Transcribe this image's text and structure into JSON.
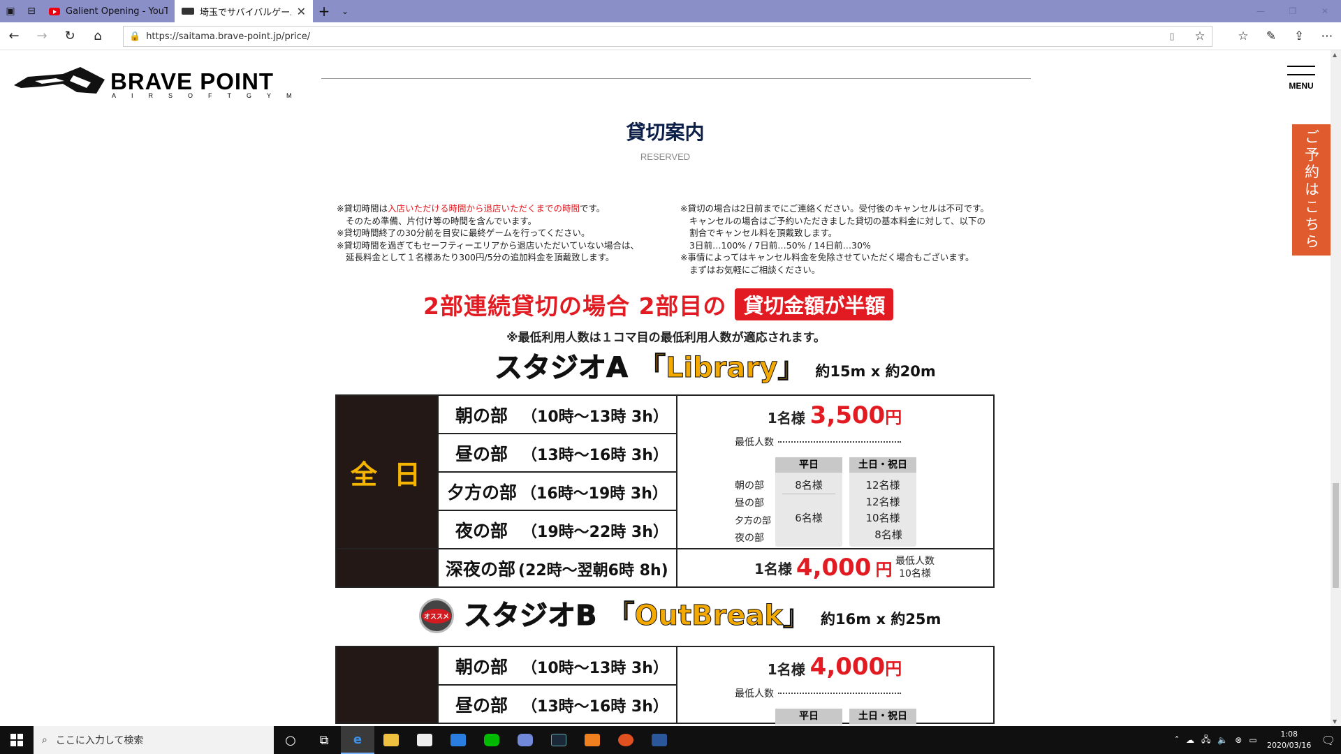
{
  "browser": {
    "tabs": [
      {
        "title": "Galient Opening - YouTube",
        "active": false
      },
      {
        "title": "埼玉でサバイバルゲームをす",
        "active": true
      }
    ],
    "url": "https://saitama.brave-point.jp/price/"
  },
  "header": {
    "logo_text": "BRAVE POINT",
    "logo_sub": "AIRSOFTGYM",
    "menu_label": "MENU",
    "reserve_tab": "ご予約はこちら"
  },
  "section": {
    "title": "貸切案内",
    "subtitle": "RESERVED"
  },
  "notes_left": {
    "l1_pre": "※貸切時間は",
    "l1_red": "入店いただける時間から退店いただくまでの時間",
    "l1_post": "です。",
    "l2": "そのため準備、片付け等の時間を含んでいます。",
    "l3": "※貸切時間終了の30分前を目安に最終ゲームを行ってください。",
    "l4": "※貸切時間を過ぎてもセーフティーエリアから退店いただいていない場合は、",
    "l5": "延長料金として１名様あたり300円/5分の追加料金を頂戴致します。"
  },
  "notes_right": {
    "l1": "※貸切の場合は2日前までにご連絡ください。受付後のキャンセルは不可です。",
    "l2": "キャンセルの場合はご予約いただきました貸切の基本料金に対して、以下の",
    "l3": "割合でキャンセル料を頂戴致します。",
    "l4": "3日前…100% / 7日前…50% / 14日前…30%",
    "l5": "※事情によってはキャンセル料金を免除させていただく場合もございます。",
    "l6": "まずはお気軽にご相談ください。"
  },
  "banner": {
    "text": "2部連続貸切の場合 2部目の",
    "highlight": "貸切金額が半額",
    "note": "※最低利用人数は１コマ目の最低利用人数が適応されます。"
  },
  "studio_a": {
    "name": "スタジオA",
    "bracket": "「Library」",
    "size": "約15m x 約20m",
    "zenjitsu": "全日",
    "slots": [
      {
        "name": "朝の部",
        "time": "（10時〜13時 3h）"
      },
      {
        "name": "昼の部",
        "time": "（13時〜16時 3h）"
      },
      {
        "name": "夕方の部",
        "time": "（16時〜19時 3h）"
      },
      {
        "name": "夜の部",
        "time": "（19時〜22時 3h）"
      },
      {
        "name": "深夜の部",
        "time": "(22時〜翌朝6時 8h)"
      }
    ],
    "price_label": "1名様",
    "price": "3,500",
    "yen": "円",
    "min_label": "最低人数",
    "col_weekday": "平日",
    "col_weekend": "土日・祝日",
    "rows": [
      "朝の部",
      "昼の部",
      "夕方の部",
      "夜の部"
    ],
    "weekday_vals": [
      "8名様",
      "6名様"
    ],
    "weekend_vals": [
      "12名様",
      "12名様",
      "10名様",
      "8名様"
    ],
    "night_price_label": "1名様",
    "night_price": "4,000",
    "night_yen": "円",
    "night_min_label": "最低人数",
    "night_min": "10名様"
  },
  "studio_b": {
    "badge": "オススメ",
    "name": "スタジオB",
    "bracket": "「OutBreak」",
    "size": "約16m x 約25m",
    "slots": [
      {
        "name": "朝の部",
        "time": "（10時〜13時 3h）"
      },
      {
        "name": "昼の部",
        "time": "（13時〜16時 3h）"
      }
    ],
    "price_label": "1名様",
    "price": "4,000",
    "yen": "円",
    "min_label": "最低人数",
    "col_weekday": "平日",
    "col_weekend": "土日・祝日"
  },
  "taskbar": {
    "search_placeholder": "ここに入力して検索",
    "time": "1:08",
    "date": "2020/03/16"
  }
}
